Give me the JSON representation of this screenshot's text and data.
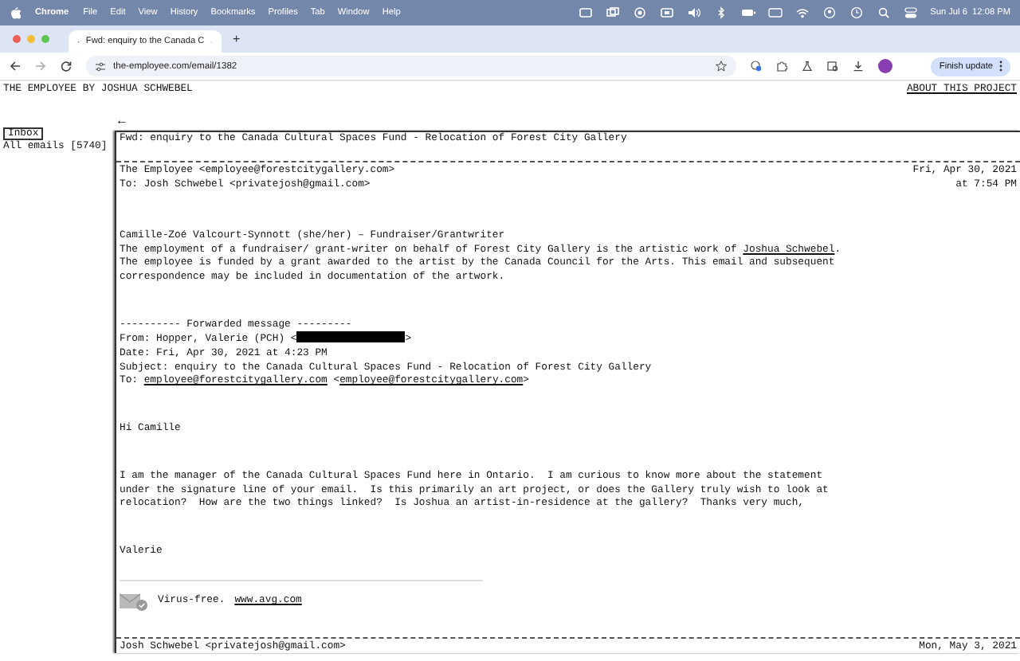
{
  "menubar": {
    "app": "Chrome",
    "menus": [
      "File",
      "Edit",
      "View",
      "History",
      "Bookmarks",
      "Profiles",
      "Tab",
      "Window",
      "Help"
    ],
    "clock": "Sun Jul 6  12:08 PM"
  },
  "browser": {
    "tab_title": "Fwd: enquiry to the Canada C",
    "new_tab": "+",
    "url": "the-employee.com/email/1382",
    "update_button": "Finish update"
  },
  "site": {
    "title": "THE EMPLOYEE BY JOSHUA SCHWEBEL",
    "about_link": "ABOUT THIS PROJECT",
    "back_arrow": "←",
    "inbox_button": "Inbox",
    "all_emails": "All emails [5740]"
  },
  "email": {
    "subject": "Fwd: enquiry to the Canada Cultural Spaces Fund - Relocation of Forest City Gallery",
    "messages": [
      {
        "from": "The Employee <employee@forestcitygallery.com>",
        "to": "To: Josh Schwebel <privatejosh@gmail.com>",
        "date": "Fri, Apr 30, 2021",
        "time": "at 7:54 PM",
        "body": [
          {
            "kind": "paragraph",
            "parts": [
              {
                "text": "Camille-Zoé Valcourt-Synnott (she/her) – Fundraiser/Grantwriter\nThe employment of a fundraiser/ grant-writer on behalf of Forest City Gallery is the artistic work of "
              },
              {
                "text": "Joshua Schwebel",
                "link": true
              },
              {
                "text": ".\nThe employee is funded by a grant awarded to the artist by the Canada Council for the Arts. This email and subsequent\ncorrespondence may be included in documentation of the artwork."
              }
            ]
          },
          {
            "kind": "paragraph",
            "parts": [
              {
                "text": "---------- Forwarded message ---------\nFrom: Hopper, Valerie (PCH) <"
              },
              {
                "redacted": true
              },
              {
                "text": ">\nDate: Fri, Apr 30, 2021 at 4:23 PM\nSubject: enquiry to the Canada Cultural Spaces Fund - Relocation of Forest City Gallery\nTo: "
              },
              {
                "text": "employee@forestcitygallery.com",
                "link": true
              },
              {
                "text": " <"
              },
              {
                "text": "employee@forestcitygallery.com",
                "link": true
              },
              {
                "text": ">"
              }
            ]
          },
          {
            "kind": "paragraph",
            "parts": [
              {
                "text": "Hi Camille"
              }
            ]
          },
          {
            "kind": "paragraph",
            "parts": [
              {
                "text": "I am the manager of the Canada Cultural Spaces Fund here in Ontario.  I am curious to know more about the statement\nunder the signature line of your email.  Is this primarily an art project, or does the Gallery truly wish to look at\nrelocation?  How are the two things linked?  Is Joshua an artist-in-residence at the gallery?  Thanks very much,"
              }
            ]
          },
          {
            "kind": "paragraph",
            "parts": [
              {
                "text": "Valerie"
              }
            ]
          },
          {
            "kind": "antivirus",
            "text": "Virus-free.",
            "link": "www.avg.com"
          }
        ]
      },
      {
        "from": "Josh Schwebel <privatejosh@gmail.com>",
        "date": "Mon, May 3, 2021"
      }
    ]
  }
}
